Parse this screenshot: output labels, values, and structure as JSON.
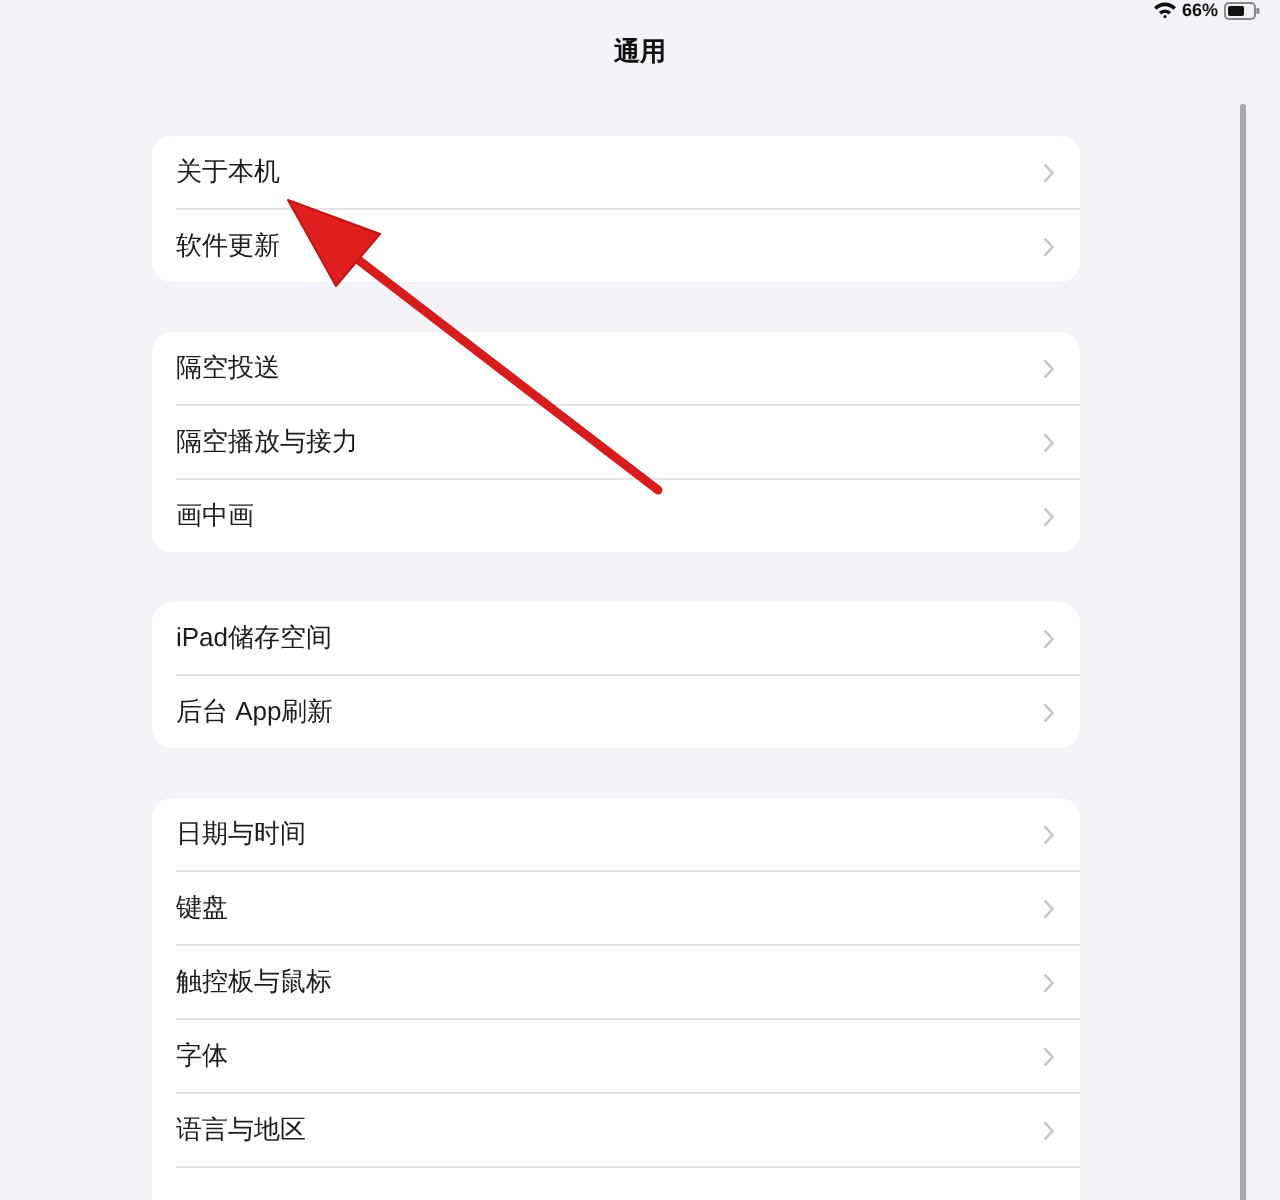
{
  "status_bar": {
    "battery_text": "66%"
  },
  "title": "通用",
  "groups": [
    {
      "items": [
        {
          "label": "关于本机"
        },
        {
          "label": "软件更新"
        }
      ]
    },
    {
      "items": [
        {
          "label": "隔空投送"
        },
        {
          "label": "隔空播放与接力"
        },
        {
          "label": "画中画"
        }
      ]
    },
    {
      "items": [
        {
          "label": "iPad储存空间"
        },
        {
          "label": "后台 App刷新"
        }
      ]
    },
    {
      "items": [
        {
          "label": "日期与时间"
        },
        {
          "label": "键盘"
        },
        {
          "label": "触控板与鼠标"
        },
        {
          "label": "字体"
        },
        {
          "label": "语言与地区"
        }
      ]
    }
  ]
}
